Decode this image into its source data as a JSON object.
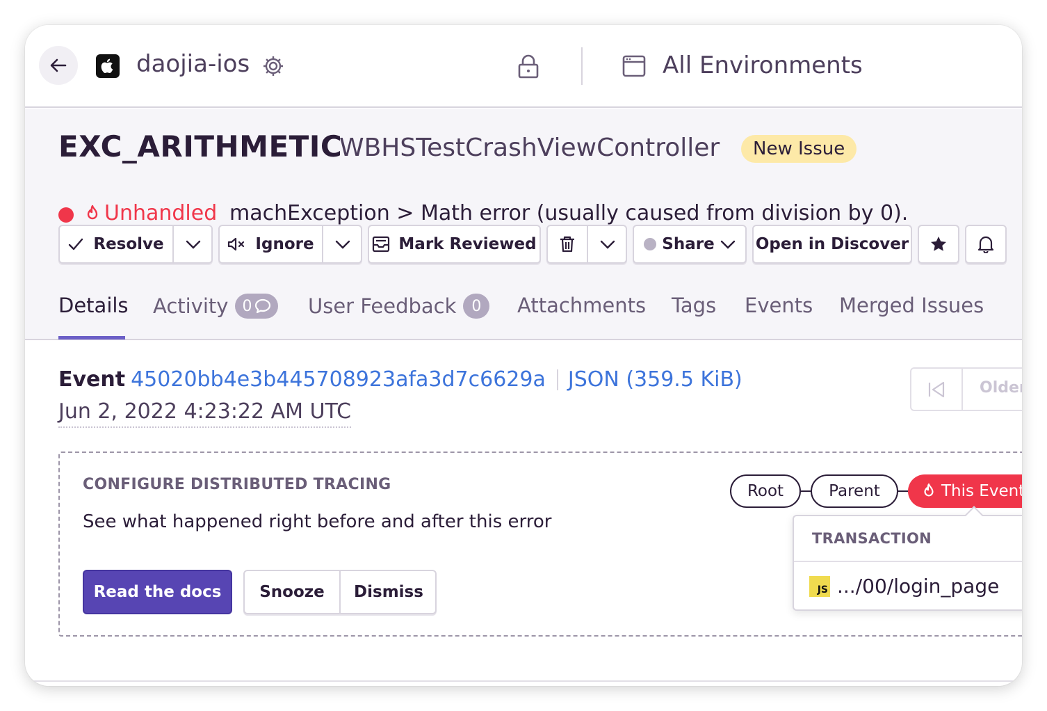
{
  "topbar": {
    "project_name": "daojia-ios",
    "environment_label": "All Environments"
  },
  "issue": {
    "title": "EXC_ARITHMETIC",
    "culprit": "WBHSTestCrashViewController",
    "badge": "New Issue",
    "unhandled_label": "Unhandled",
    "message": "machException > Math error (usually caused from division by 0)."
  },
  "actions": {
    "resolve": "Resolve",
    "ignore": "Ignore",
    "mark_reviewed": "Mark Reviewed",
    "share": "Share",
    "open_in_discover": "Open in Discover"
  },
  "tabs": {
    "details": "Details",
    "activity": "Activity",
    "activity_count": "0",
    "user_feedback": "User Feedback",
    "user_feedback_count": "0",
    "attachments": "Attachments",
    "tags": "Tags",
    "events": "Events",
    "merged_issues": "Merged Issues"
  },
  "event": {
    "label": "Event",
    "id": "45020bb4e3b445708923afa3d7c6629a",
    "json_link": "JSON (359.5 KiB)",
    "date": "Jun 2, 2022 4:23:22 AM UTC",
    "older_label": "Older"
  },
  "tracing": {
    "heading": "CONFIGURE DISTRIBUTED TRACING",
    "description": "See what happened right before and after this error",
    "read_docs": "Read the docs",
    "snooze": "Snooze",
    "dismiss": "Dismiss",
    "root": "Root",
    "parent": "Parent",
    "this_event": "This Event",
    "transaction_heading": "TRANSACTION",
    "transaction_name": ".../00/login_page",
    "transaction_icon_text": "JS"
  },
  "colors": {
    "accent": "#6c5fc7",
    "primary_button": "#5745b3",
    "error_red": "#f0364a",
    "link_blue": "#3d74db",
    "new_issue_badge": "#fde9a8"
  },
  "icons": [
    "arrow-left-icon",
    "apple-icon",
    "gear-icon",
    "lock-icon",
    "calendar-icon",
    "checkmark-icon",
    "chevron-down-icon",
    "mute-icon",
    "inbox-icon",
    "trash-icon",
    "star-icon",
    "bell-icon",
    "fire-icon",
    "comment-icon",
    "first-page-icon"
  ]
}
